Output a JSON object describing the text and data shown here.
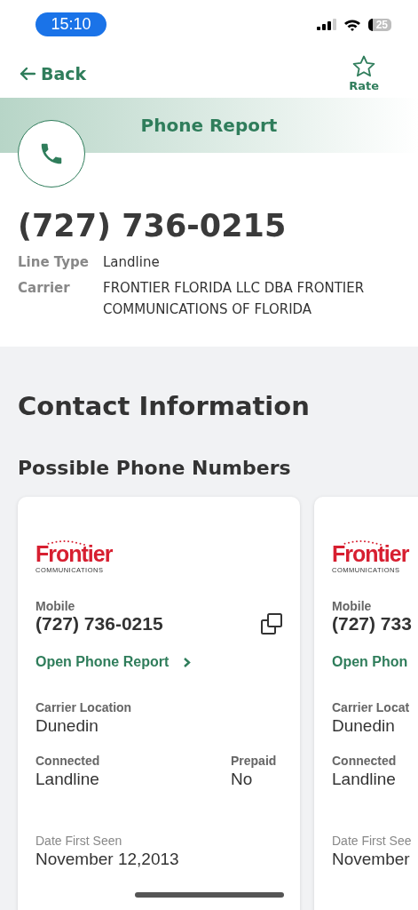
{
  "status_bar": {
    "time": "15:10",
    "battery": "25"
  },
  "nav": {
    "back": "Back",
    "rate": "Rate"
  },
  "header": {
    "title": "Phone Report"
  },
  "phone": {
    "number": "(727) 736-0215",
    "details": [
      {
        "label": "Line Type",
        "value": "Landline"
      },
      {
        "label": "Carrier",
        "value": "FRONTIER FLORIDA LLC DBA FRONTIER COMMUNICATIONS OF FLORIDA"
      }
    ]
  },
  "contact": {
    "title": "Contact Information",
    "subtitle": "Possible Phone Numbers",
    "cards": [
      {
        "logo": "Frontier",
        "logo_sub": "COMMUNICATIONS",
        "type": "Mobile",
        "number": "(727) 736-0215",
        "link": "Open Phone Report",
        "location_label": "Carrier Location",
        "location": "Dunedin",
        "connected_label": "Connected",
        "connected": "Landline",
        "prepaid_label": "Prepaid",
        "prepaid": "No",
        "date_label": "Date First Seen",
        "date": "November 12,2013"
      },
      {
        "logo": "Frontier",
        "logo_sub": "COMMUNICATIONS",
        "type": "Mobile",
        "number": "(727) 733",
        "link": "Open Phon",
        "location_label": "Carrier Locat",
        "location": "Dunedin",
        "connected_label": "Connected",
        "connected": "Landline",
        "date_label": "Date First See",
        "date": "November"
      }
    ]
  }
}
